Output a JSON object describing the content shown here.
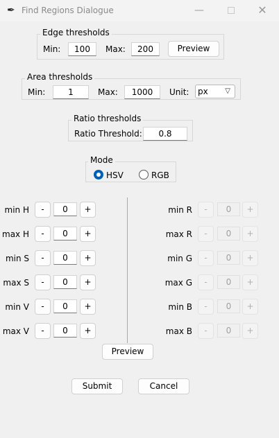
{
  "window": {
    "title": "Find Regions Dialogue",
    "icon": "feather-icon",
    "minimize_glyph": "—",
    "close_glyph": "✕"
  },
  "edge": {
    "title": "Edge thresholds",
    "min_label": "Min:",
    "min_value": "100",
    "max_label": "Max:",
    "max_value": "200",
    "preview_label": "Preview"
  },
  "area": {
    "title": "Area thresholds",
    "min_label": "Min:",
    "min_value": "1",
    "max_label": "Max:",
    "max_value": "1000",
    "unit_label": "Unit:",
    "unit_value": "px"
  },
  "ratio": {
    "title": "Ratio thresholds",
    "label": "Ratio Threshold:",
    "value": "0.8"
  },
  "mode": {
    "title": "Mode",
    "options": [
      "HSV",
      "RGB"
    ],
    "selected": "HSV"
  },
  "hsv": [
    {
      "label": "min H",
      "value": "0"
    },
    {
      "label": "max H",
      "value": "0"
    },
    {
      "label": "min S",
      "value": "0"
    },
    {
      "label": "max S",
      "value": "0"
    },
    {
      "label": "min V",
      "value": "0"
    },
    {
      "label": "max V",
      "value": "0"
    }
  ],
  "rgb": [
    {
      "label": "min R",
      "value": "0"
    },
    {
      "label": "max R",
      "value": "0"
    },
    {
      "label": "min G",
      "value": "0"
    },
    {
      "label": "max G",
      "value": "0"
    },
    {
      "label": "min B",
      "value": "0"
    },
    {
      "label": "max B",
      "value": "0"
    }
  ],
  "stepper": {
    "minus": "-",
    "plus": "+"
  },
  "color_preview_label": "Preview",
  "footer": {
    "submit_label": "Submit",
    "cancel_label": "Cancel"
  },
  "colors": {
    "accent": "#005fb8",
    "background": "#f0f0f0"
  }
}
